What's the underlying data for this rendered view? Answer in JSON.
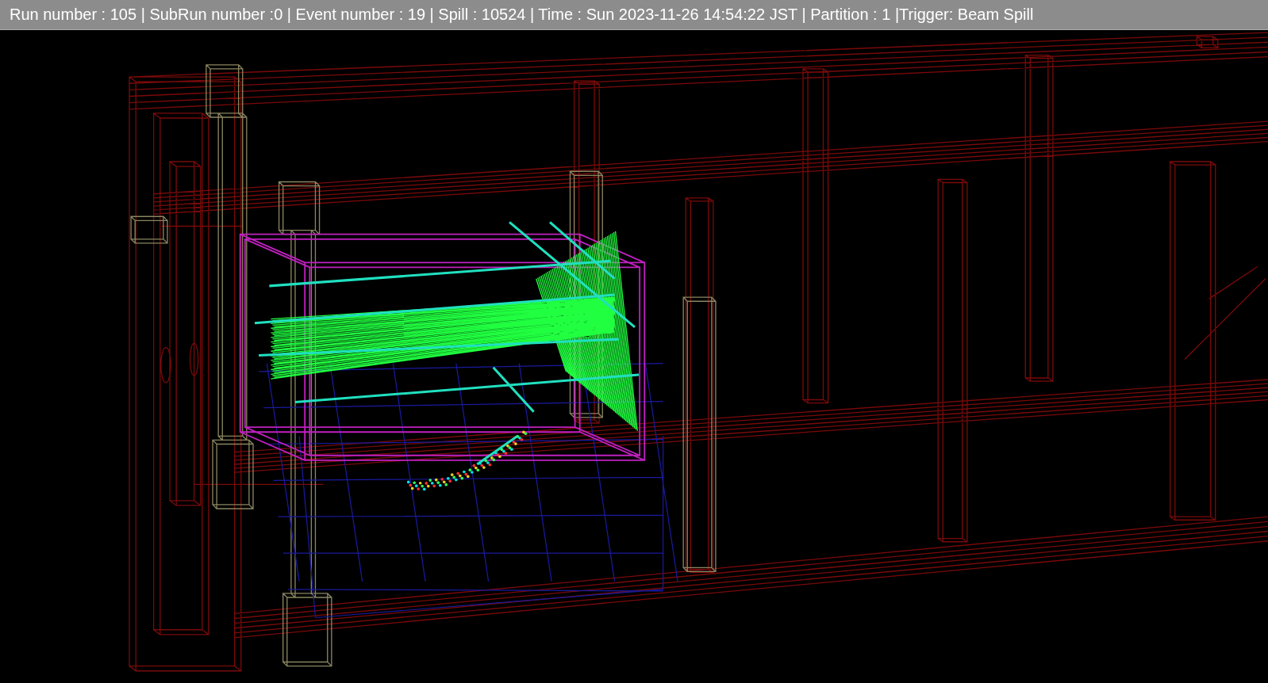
{
  "header": {
    "text": "Run number : 105 | SubRun number :0 | Event number : 19 | Spill : 10524 | Time : Sun 2023-11-26 14:54:22 JST | Partition : 1 |Trigger: Beam Spill"
  }
}
